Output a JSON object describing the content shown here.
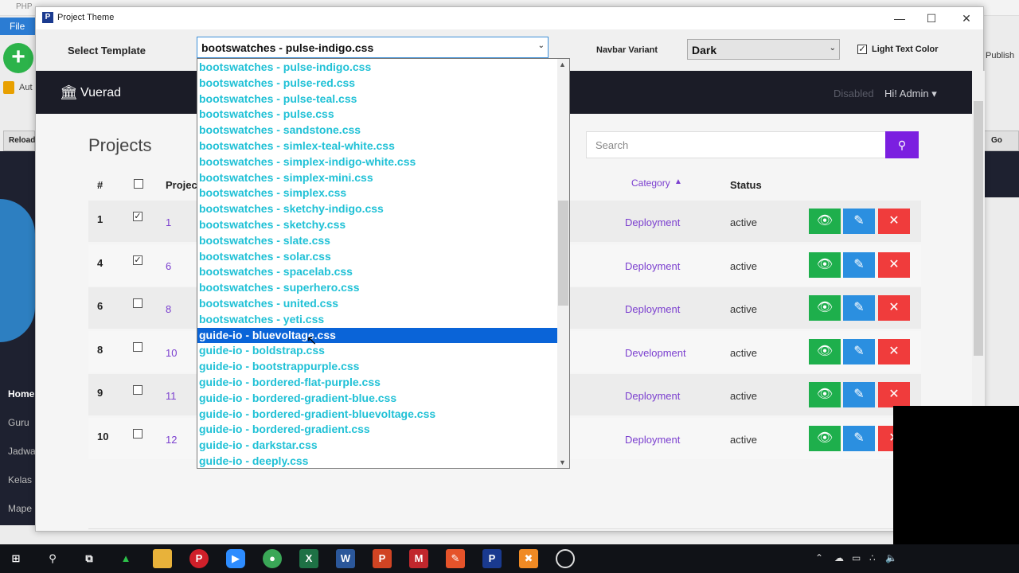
{
  "background_app": {
    "title_fragment": "PHP",
    "menu_file": "File",
    "aut_label": "Aut",
    "reload_label": "Reload",
    "publish_label": "Publish",
    "go_label": "Go",
    "sidebar_items": [
      "Home",
      "Guru",
      "Jadwa",
      "Kelas",
      "Mape"
    ]
  },
  "dialog": {
    "title": "Project Theme",
    "controls": {
      "minimize": "—",
      "maximize": "☐",
      "close": "✕"
    },
    "select_template_label": "Select Template",
    "selected_template": "bootswatches - pulse-indigo.css",
    "navbar_variant_label": "Navbar Variant",
    "navbar_variant_value": "Dark",
    "light_text_label": "Light Text Color",
    "light_text_checked": true
  },
  "preview": {
    "brand": "Vuerad",
    "nav_disabled": "Disabled",
    "nav_user": "Hi! Admin",
    "page_title": "Projects",
    "search_placeholder": "Search",
    "headers": {
      "num": "#",
      "project": "Projec",
      "category": "Category",
      "status": "Status"
    },
    "rows": [
      {
        "num": "1",
        "checked": true,
        "id": "1",
        "category": "Deployment",
        "status": "active"
      },
      {
        "num": "4",
        "checked": true,
        "id": "6",
        "category": "Deployment",
        "status": "active"
      },
      {
        "num": "6",
        "checked": false,
        "id": "8",
        "category": "Deployment",
        "status": "active"
      },
      {
        "num": "8",
        "checked": false,
        "id": "10",
        "category": "Development",
        "status": "active"
      },
      {
        "num": "9",
        "checked": false,
        "id": "11",
        "category": "Deployment",
        "status": "active"
      },
      {
        "num": "10",
        "checked": false,
        "id": "12",
        "category": "Deployment",
        "status": "active"
      }
    ]
  },
  "dropdown": {
    "selected_index": 17,
    "items": [
      "bootswatches - pulse-indigo.css",
      "bootswatches - pulse-red.css",
      "bootswatches - pulse-teal.css",
      "bootswatches - pulse.css",
      "bootswatches - sandstone.css",
      "bootswatches - simlex-teal-white.css",
      "bootswatches - simplex-indigo-white.css",
      "bootswatches - simplex-mini.css",
      "bootswatches - simplex.css",
      "bootswatches - sketchy-indigo.css",
      "bootswatches - sketchy.css",
      "bootswatches - slate.css",
      "bootswatches - solar.css",
      "bootswatches - spacelab.css",
      "bootswatches - superhero.css",
      "bootswatches - united.css",
      "bootswatches - yeti.css",
      "guide-io - bluevoltage.css",
      "guide-io - boldstrap.css",
      "guide-io - bootstrappurple.css",
      "guide-io - bordered-flat-purple.css",
      "guide-io - bordered-gradient-blue.css",
      "guide-io - bordered-gradient-bluevoltage.css",
      "guide-io - bordered-gradient.css",
      "guide-io - darkstar.css",
      "guide-io - deeply.css"
    ]
  },
  "taskbar": {
    "icons": [
      "windows-start",
      "search",
      "task-view",
      "app-green",
      "file-explorer",
      "pinterest",
      "zoom",
      "chrome",
      "excel",
      "word",
      "powerpoint",
      "app-red",
      "app-orange",
      "phpmaker",
      "app-xampp",
      "app-record"
    ]
  },
  "colors": {
    "dropdown_text": "#20c1d6",
    "dropdown_selected_bg": "#0a64d8",
    "navbar_bg": "#1b1c27",
    "accent": "#7b3fcf",
    "search_button": "#7b1fe0",
    "view_button": "#1eaf4c",
    "edit_button": "#2b8fe0",
    "delete_button": "#f03c3c"
  }
}
